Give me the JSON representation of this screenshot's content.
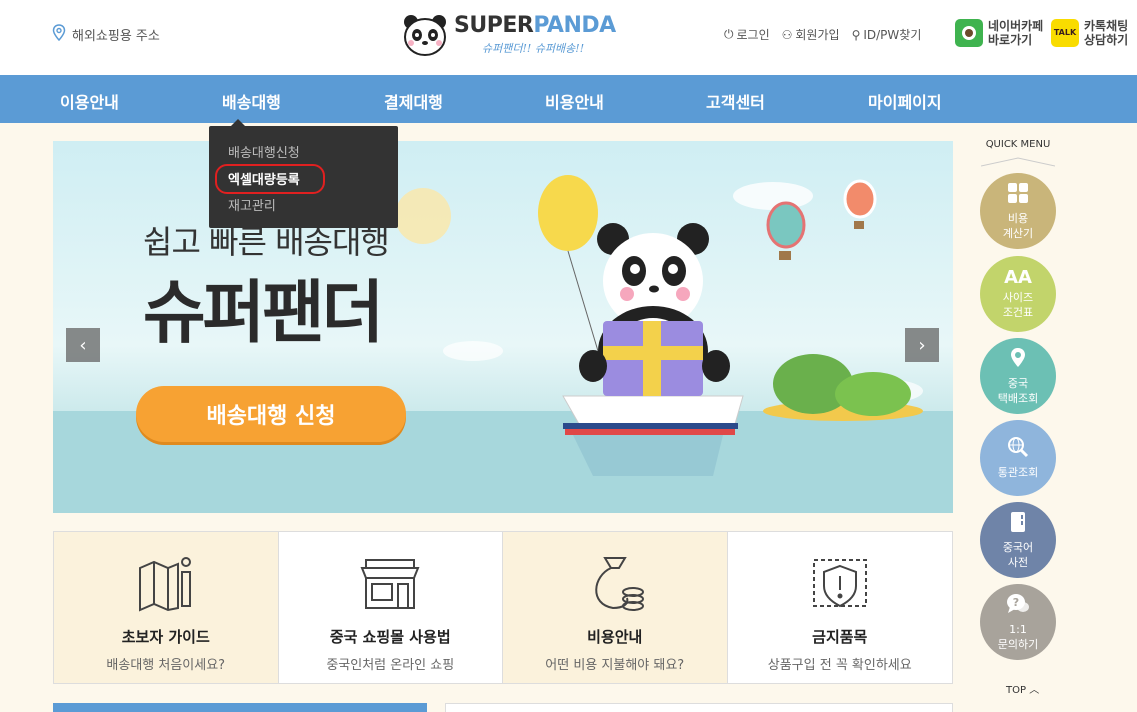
{
  "header": {
    "address_label": "해외쇼핑용 주소",
    "logo_title_a": "SUPER",
    "logo_title_b": "PANDA",
    "logo_sub": "슈퍼팬더!! 슈퍼배송!!",
    "links": [
      "로그인",
      "회원가입",
      "ID/PW찾기"
    ],
    "cafe_label_1": "네이버카페",
    "cafe_label_2": "바로가기",
    "kakao_label_1": "카톡채팅",
    "kakao_label_2": "상담하기",
    "kakao_icon_text": "TALK"
  },
  "nav": {
    "items": [
      "이용안내",
      "배송대행",
      "결제대행",
      "비용안내",
      "고객센터",
      "마이페이지"
    ]
  },
  "dropdown": {
    "items": [
      "배송대행신청",
      "엑셀대량등록",
      "재고관리"
    ],
    "active_index": 1
  },
  "banner": {
    "subtitle": "쉽고 빠른 배송대행",
    "title": "슈퍼팬더",
    "cta": "배송대행 신청",
    "prev": "‹",
    "next": "›"
  },
  "features": [
    {
      "title": "초보자 가이드",
      "desc": "배송대행 처음이세요?",
      "icon": "map-info-icon"
    },
    {
      "title": "중국 쇼핑몰 사용법",
      "desc": "중국인처럼 온라인 쇼핑",
      "icon": "store-icon"
    },
    {
      "title": "비용안내",
      "desc": "어떤 비용 지불해야 돼요?",
      "icon": "money-bag-icon"
    },
    {
      "title": "금지품목",
      "desc": "상품구입 전 꼭 확인하세요",
      "icon": "shield-warning-icon"
    }
  ],
  "quick_menu": {
    "title": "QUICK MENU",
    "items": [
      {
        "label": "비용\n계산기",
        "color": "#c9b57a",
        "icon": "calculator-icon"
      },
      {
        "label": "사이즈\n조건표",
        "color": "#c2d46b",
        "icon": "size-chart-icon",
        "glyph": "AA"
      },
      {
        "label": "중국\n택배조회",
        "color": "#6cc0b4",
        "icon": "location-pin-icon"
      },
      {
        "label": "통관조회",
        "color": "#8fb5dc",
        "icon": "globe-search-icon"
      },
      {
        "label": "중국어\n사전",
        "color": "#6f84a8",
        "icon": "book-icon"
      },
      {
        "label": "1:1\n문의하기",
        "color": "#a8a39b",
        "icon": "chat-question-icon"
      }
    ],
    "top_label": "TOP"
  },
  "colors": {
    "nav_bg": "#5b9bd5",
    "cta": "#f7a233",
    "page_bg": "#fdf8ec"
  }
}
